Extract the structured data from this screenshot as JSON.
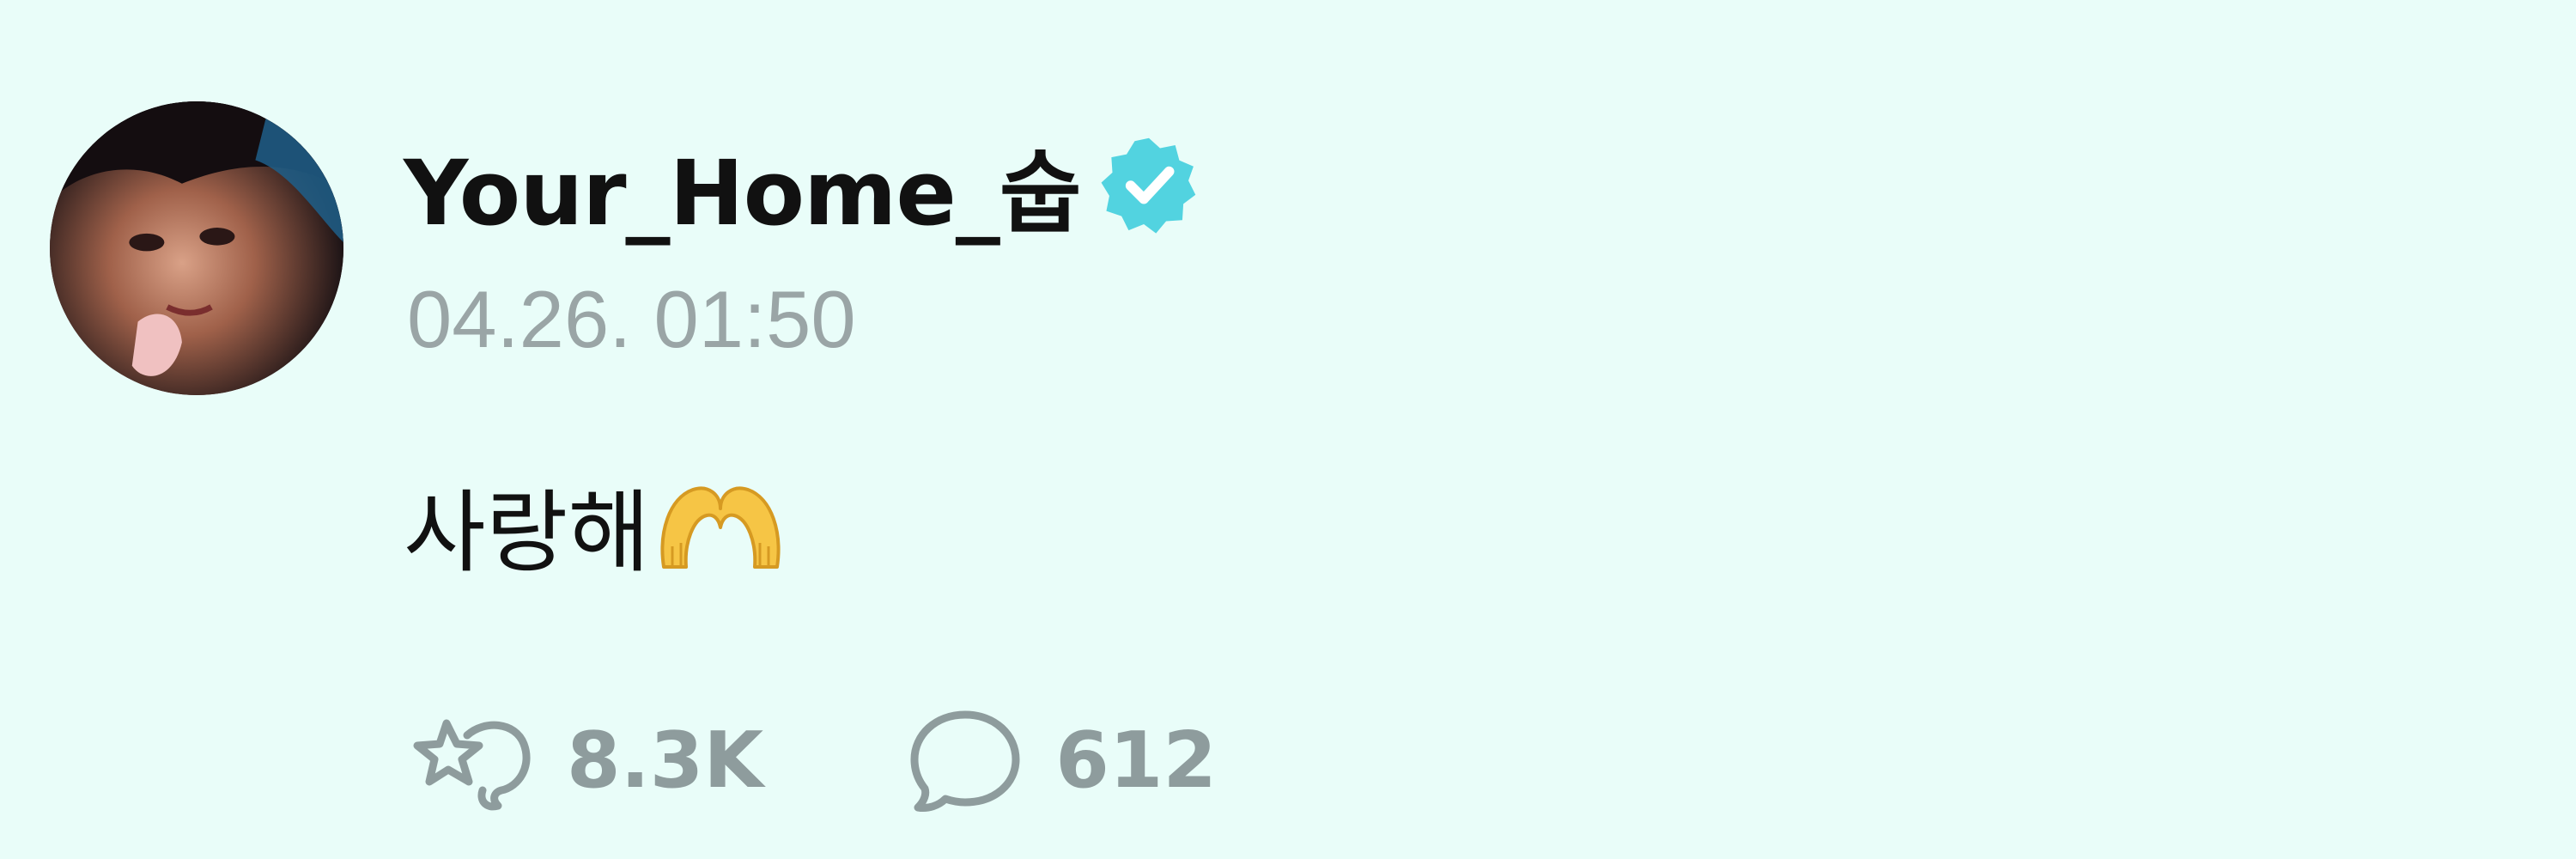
{
  "post": {
    "username": "Your_Home_숩",
    "verified": true,
    "timestamp": "04.26. 01:50",
    "message": "사랑해",
    "message_emoji": "heart-hands-emoji",
    "stats": {
      "reactions_count": "8.3K",
      "comments_count": "612"
    }
  },
  "icons": {
    "verified": "verified-badge-icon",
    "reaction": "star-hand-reaction-icon",
    "comment": "comment-bubble-icon"
  },
  "colors": {
    "background": "#e9fdf9",
    "verified_badge": "#52d3e0",
    "muted_text": "#9aa5a6",
    "count_text": "#8e9c9d"
  }
}
